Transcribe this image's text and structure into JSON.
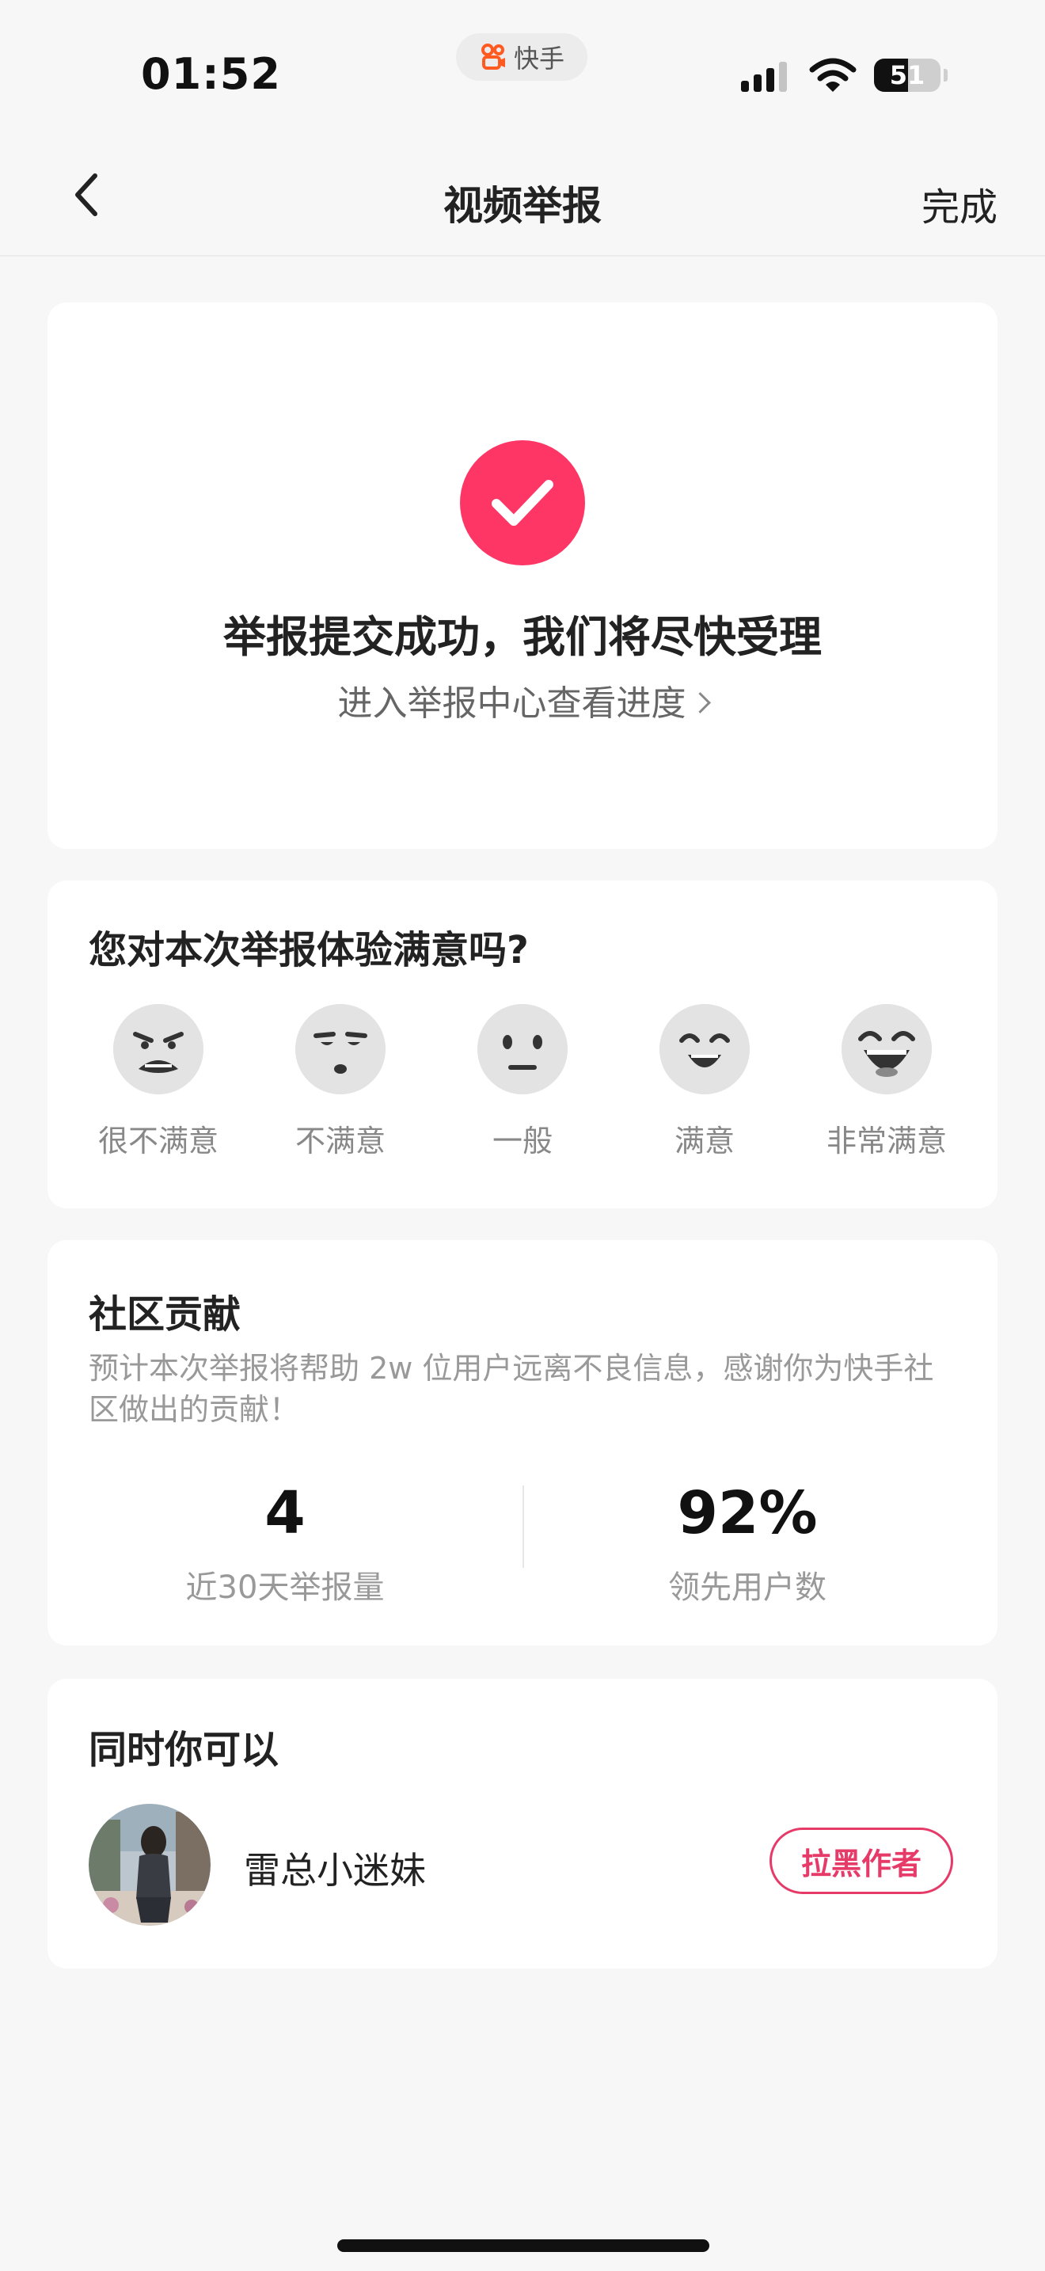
{
  "status_bar": {
    "time": "01:52",
    "app_name": "快手",
    "battery_level": "51",
    "battery_fraction": 0.51
  },
  "nav": {
    "title": "视频举报",
    "done_label": "完成"
  },
  "success": {
    "title": "举报提交成功，我们将尽快受理",
    "link": "进入举报中心查看进度"
  },
  "rating": {
    "question": "您对本次举报体验满意吗?",
    "options": [
      {
        "label": "很不满意",
        "icon": "very-unsatisfied-face-icon"
      },
      {
        "label": "不满意",
        "icon": "unsatisfied-face-icon"
      },
      {
        "label": "一般",
        "icon": "neutral-face-icon"
      },
      {
        "label": "满意",
        "icon": "satisfied-face-icon"
      },
      {
        "label": "非常满意",
        "icon": "very-satisfied-face-icon"
      }
    ]
  },
  "contribution": {
    "heading": "社区贡献",
    "description": "预计本次举报将帮助 2w 位用户远离不良信息，感谢你为快手社区做出的贡献！",
    "stats": [
      {
        "value": "4",
        "label": "近30天举报量"
      },
      {
        "value": "92%",
        "label": "领先用户数"
      }
    ]
  },
  "actions": {
    "heading": "同时你可以",
    "author_name": "雷总小迷妹",
    "block_label": "拉黑作者"
  },
  "colors": {
    "accent": "#fe3666",
    "block_button": "#e63b68",
    "background": "#f7f7f7"
  }
}
